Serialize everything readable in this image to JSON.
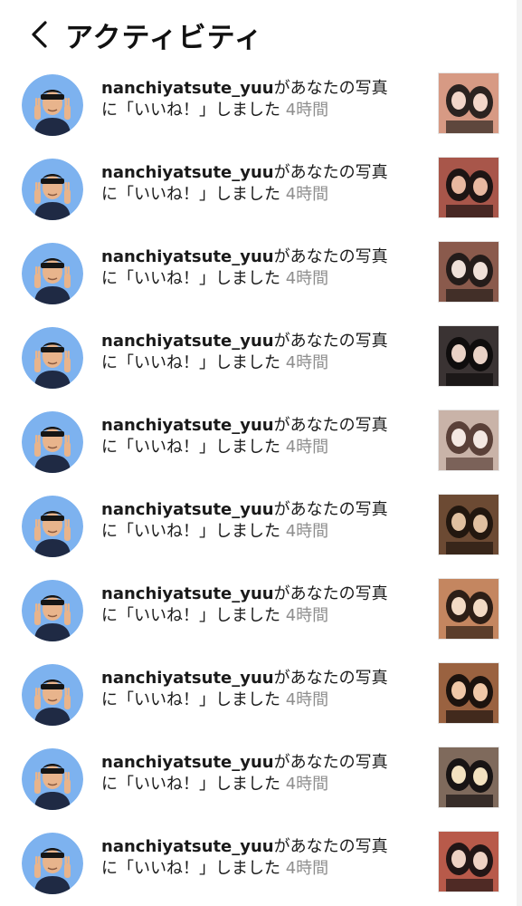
{
  "header": {
    "title": "アクティビティ",
    "back_icon": "chevron-left-icon"
  },
  "activity": {
    "items": [
      {
        "username": "nanchiyatsute_yuu",
        "message_line1": "があなたの写真",
        "message_line2": "に「いいね！」しました",
        "time": "4時間",
        "thumb_colors": [
          "#d79a84",
          "#2b2320",
          "#f2d6c9"
        ]
      },
      {
        "username": "nanchiyatsute_yuu",
        "message_line1": "があなたの写真",
        "message_line2": "に「いいね！」しました",
        "time": "4時間",
        "thumb_colors": [
          "#a8564a",
          "#1e1514",
          "#e8b8a0"
        ]
      },
      {
        "username": "nanchiyatsute_yuu",
        "message_line1": "があなたの写真",
        "message_line2": "に「いいね！」しました",
        "time": "4時間",
        "thumb_colors": [
          "#8a5a4c",
          "#241c1a",
          "#efe0d8"
        ]
      },
      {
        "username": "nanchiyatsute_yuu",
        "message_line1": "があなたの写真",
        "message_line2": "に「いいね！」しました",
        "time": "4時間",
        "thumb_colors": [
          "#3a3333",
          "#0f0d0d",
          "#e9d2c6"
        ]
      },
      {
        "username": "nanchiyatsute_yuu",
        "message_line1": "があなたの写真",
        "message_line2": "に「いいね！」しました",
        "time": "4時間",
        "thumb_colors": [
          "#c9b3a8",
          "#5a4038",
          "#f4e8e2"
        ]
      },
      {
        "username": "nanchiyatsute_yuu",
        "message_line1": "があなたの写真",
        "message_line2": "に「いいね！」しました",
        "time": "4時間",
        "thumb_colors": [
          "#6c4a33",
          "#22170f",
          "#e0c0a0"
        ]
      },
      {
        "username": "nanchiyatsute_yuu",
        "message_line1": "があなたの写真",
        "message_line2": "に「いいね！」しました",
        "time": "4時間",
        "thumb_colors": [
          "#c48660",
          "#2d1e16",
          "#f3dac4"
        ]
      },
      {
        "username": "nanchiyatsute_yuu",
        "message_line1": "があなたの写真",
        "message_line2": "に「いいね！」しました",
        "time": "4時間",
        "thumb_colors": [
          "#9a6240",
          "#1c130e",
          "#f0c8a8"
        ]
      },
      {
        "username": "nanchiyatsute_yuu",
        "message_line1": "があなたの写真",
        "message_line2": "に「いいね！」しました",
        "time": "4時間",
        "thumb_colors": [
          "#7f6a5c",
          "#181414",
          "#f3e2c0"
        ]
      },
      {
        "username": "nanchiyatsute_yuu",
        "message_line1": "があなたの写真",
        "message_line2": "に「いいね！」しました",
        "time": "4時間",
        "thumb_colors": [
          "#b85a4a",
          "#221616",
          "#eed2c4"
        ]
      }
    ]
  }
}
